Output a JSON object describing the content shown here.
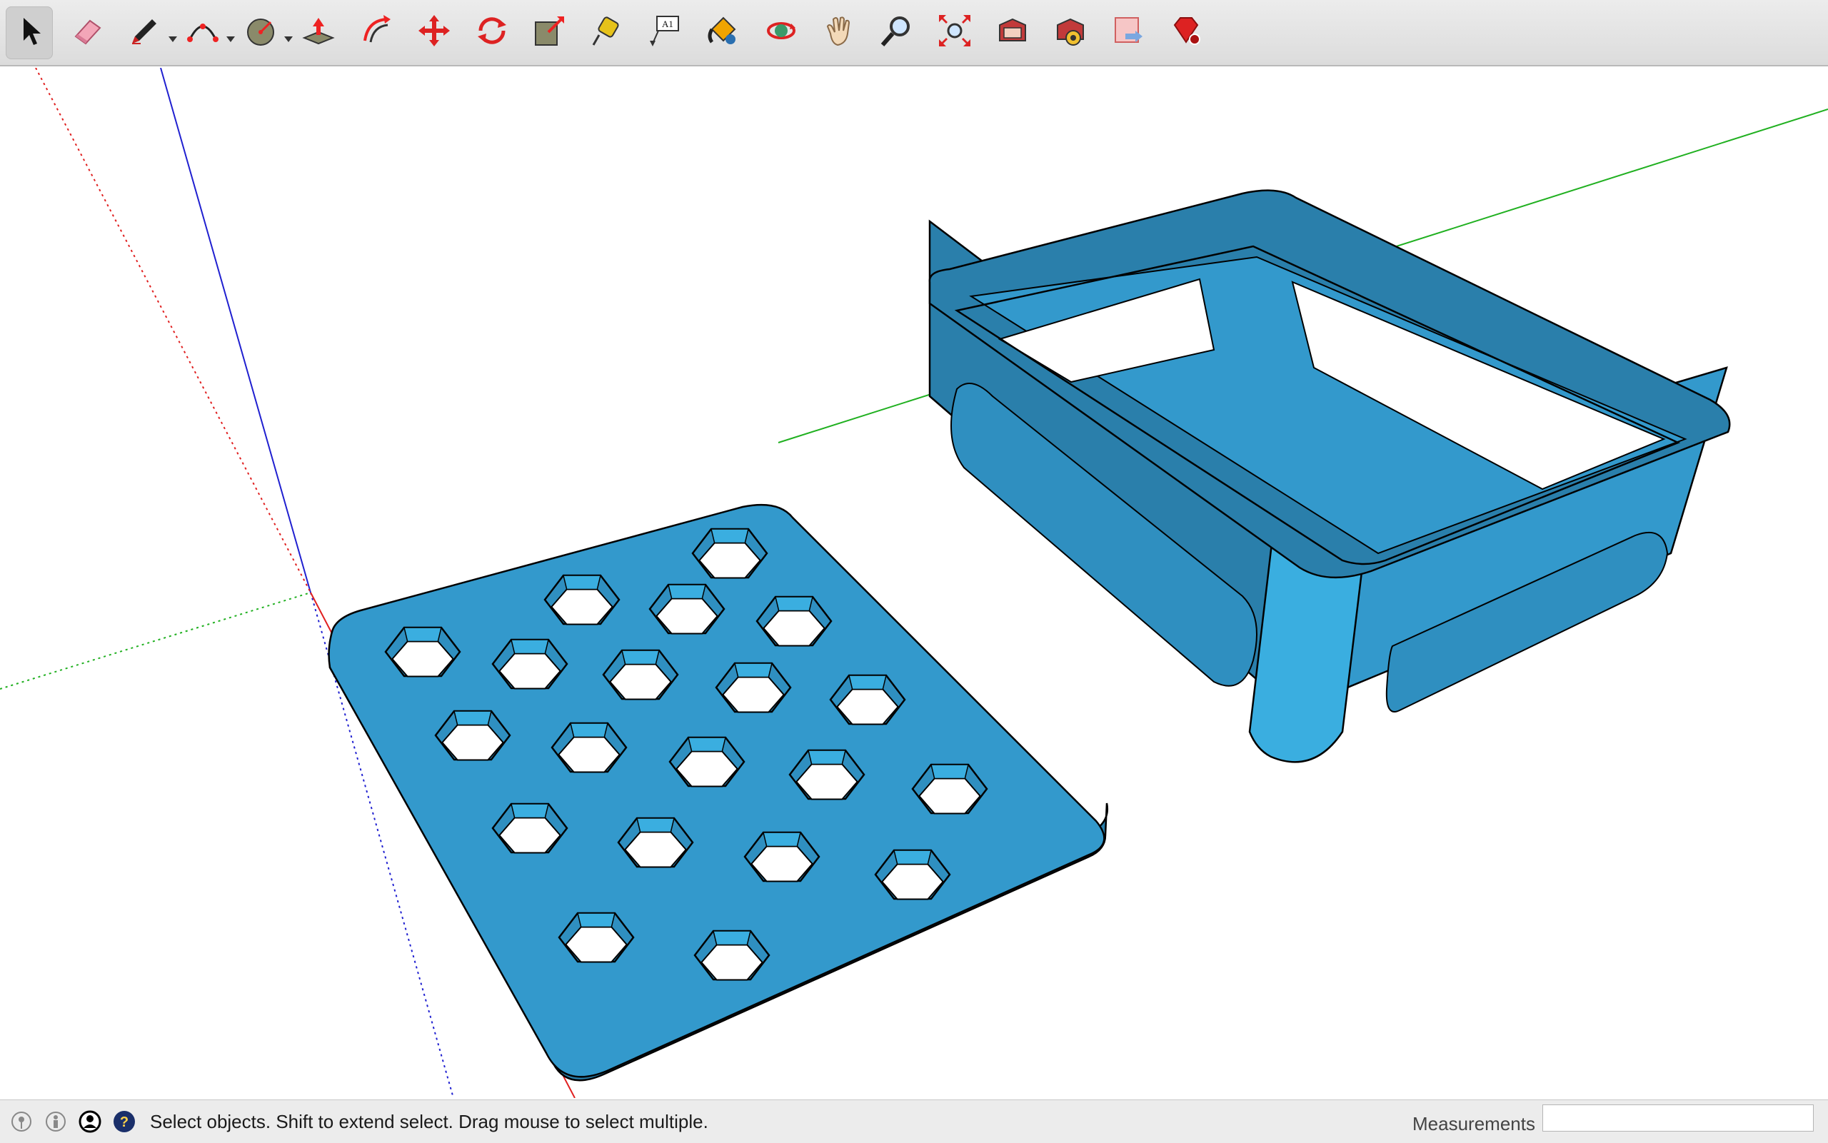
{
  "toolbar": {
    "tools": [
      {
        "name": "select-tool",
        "icon": "arrow-cursor-icon",
        "active": true
      },
      {
        "name": "eraser-tool",
        "icon": "eraser-icon"
      },
      {
        "name": "line-tool",
        "icon": "pencil-icon",
        "dropdown": true
      },
      {
        "name": "arc-tool",
        "icon": "arc-icon",
        "dropdown": true
      },
      {
        "name": "shapes-tool",
        "icon": "circle-shape-icon",
        "dropdown": true
      },
      {
        "name": "push-pull-tool",
        "icon": "push-pull-icon"
      },
      {
        "name": "offset-tool",
        "icon": "offset-icon"
      },
      {
        "name": "move-tool",
        "icon": "move-arrows-icon"
      },
      {
        "name": "rotate-tool",
        "icon": "rotate-icon"
      },
      {
        "name": "scale-tool",
        "icon": "scale-icon"
      },
      {
        "name": "tape-measure-tool",
        "icon": "tape-measure-icon"
      },
      {
        "name": "text-tool",
        "icon": "text-label-icon"
      },
      {
        "name": "paint-bucket-tool",
        "icon": "paint-bucket-icon"
      },
      {
        "name": "orbit-tool",
        "icon": "orbit-icon"
      },
      {
        "name": "pan-tool",
        "icon": "hand-icon"
      },
      {
        "name": "zoom-tool",
        "icon": "magnifier-icon"
      },
      {
        "name": "zoom-extents-tool",
        "icon": "zoom-extents-icon"
      },
      {
        "name": "warehouse-tool",
        "icon": "warehouse-icon"
      },
      {
        "name": "extension-warehouse-tool",
        "icon": "extension-warehouse-icon"
      },
      {
        "name": "layout-tool",
        "icon": "layout-icon"
      },
      {
        "name": "ruby-console-tool",
        "icon": "ruby-gem-icon"
      }
    ],
    "text_tool_label": "A1"
  },
  "status": {
    "message": "Select objects. Shift to extend select. Drag mouse to select multiple.",
    "measurements_label": "Measurements",
    "measurements_value": ""
  },
  "colors": {
    "model_blue": "#3399cc",
    "model_blue_dark": "#2a7fab",
    "model_blue_light": "#3aaee0",
    "axis_red": "#e02020",
    "axis_green": "#20b020",
    "axis_blue": "#2020d0"
  }
}
